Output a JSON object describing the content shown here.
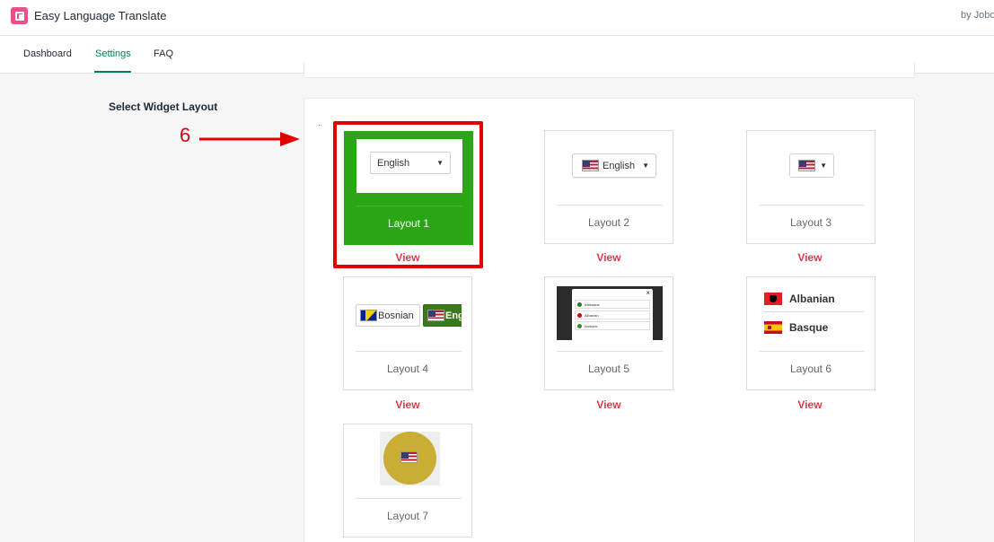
{
  "app": {
    "title": "Easy Language Translate",
    "by_text": "by Jobo"
  },
  "nav": {
    "tabs": [
      {
        "label": "Dashboard"
      },
      {
        "label": "Settings",
        "active": true
      },
      {
        "label": "FAQ"
      }
    ]
  },
  "section": {
    "label": "Select Widget Layout"
  },
  "annotation": {
    "number": "6",
    "color": "#e20000"
  },
  "layouts": [
    {
      "caption": "Layout 1",
      "view_label": "View",
      "selected": true,
      "preview": {
        "select_text": "English"
      }
    },
    {
      "caption": "Layout 2",
      "view_label": "View",
      "preview": {
        "select_text": "English"
      }
    },
    {
      "caption": "Layout 3",
      "view_label": "View"
    },
    {
      "caption": "Layout 4",
      "view_label": "View",
      "preview": {
        "btn1": "Bosnian",
        "btn2": "English"
      }
    },
    {
      "caption": "Layout 5",
      "view_label": "View",
      "preview": {
        "rows": [
          "Afrikaans",
          "Albanian",
          "Amharic"
        ],
        "close": "×"
      }
    },
    {
      "caption": "Layout 6",
      "view_label": "View",
      "preview": {
        "items": [
          "Albanian",
          "Basque"
        ]
      }
    },
    {
      "caption": "Layout 7"
    }
  ],
  "colors": {
    "accent": "#008060",
    "selected_tile": "#2aa515",
    "view_link": "#e5364a"
  }
}
